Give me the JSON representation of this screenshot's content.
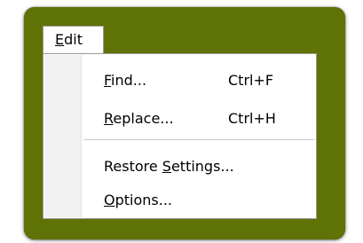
{
  "menu": {
    "title_key": "E",
    "title_rest": "dit",
    "items": [
      {
        "key": "F",
        "rest": "ind...",
        "shortcut": "Ctrl+F"
      },
      {
        "key": "R",
        "rest": "eplace...",
        "shortcut": "Ctrl+H"
      },
      {
        "before": "Restore ",
        "key": "S",
        "rest": "ettings..."
      },
      {
        "key": "O",
        "rest": "ptions..."
      }
    ]
  },
  "colors": {
    "frame": "#5f7206",
    "menu_background": "#ffffff",
    "gutter": "#f1f1f1",
    "border": "#9a9a9a",
    "separator": "#c8c8c8"
  }
}
